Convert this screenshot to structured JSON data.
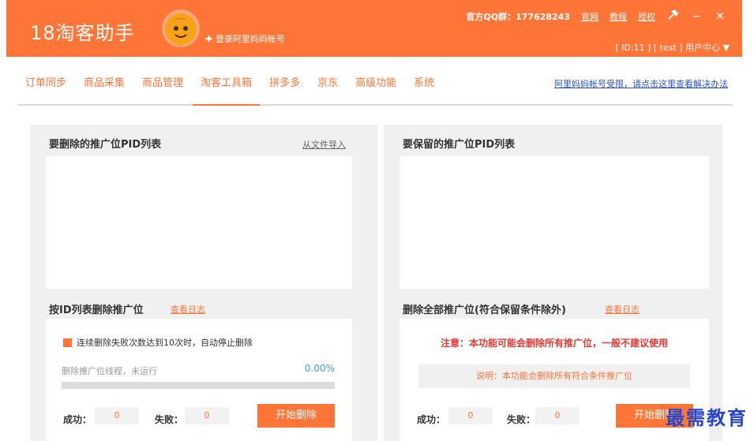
{
  "header": {
    "app_title": "18淘客助手",
    "login_link": "✚ 登录阿里妈妈帐号",
    "qq_group": "官方QQ群：177628243",
    "links": [
      "官网",
      "教程",
      "授权"
    ],
    "controls": {
      "settings": "✖",
      "minimize": "−",
      "close": "✕"
    },
    "user_line": "[ ID:11 ] [ test ] 用户中心 ▼"
  },
  "nav": {
    "tabs": [
      "订单同步",
      "商品采集",
      "商品管理",
      "淘客工具箱",
      "拼多多",
      "京东",
      "高级功能",
      "系统"
    ],
    "active_tab": "淘客工具箱",
    "help_link": "阿里妈妈帐号受限，请点击这里查看解决办法"
  },
  "left_panel": {
    "title": "要删除的推广位PID列表",
    "import_link": "从文件导入",
    "sub_title": "按ID列表删除推广位",
    "log_link": "查看日志",
    "checkbox_label": "连续删除失败次数达到10次时，自动停止删除",
    "progress_label": "删除推广位线程，未运行",
    "progress_pct": "0.00%",
    "progress_fraction": 0,
    "success_label": "成功：",
    "success_value": "0",
    "fail_label": "失败：",
    "fail_value": "0",
    "button_label": "开始删除"
  },
  "right_panel": {
    "title": "要保留的推广位PID列表",
    "sub_title": "删除全部推广位(符合保留条件除外)",
    "log_link": "查看日志",
    "warning": "注意：本功能可能会删除所有推广位，一般不建议使用",
    "description": "说明：本功能会删除所有符合条件推广位",
    "success_label": "成功：",
    "success_value": "0",
    "fail_label": "失败：",
    "fail_value": "0",
    "button_label": "开始删除"
  },
  "watermark": "最需教育",
  "colors": {
    "accent": "#fe7537",
    "link_blue": "#2b52c4",
    "progress_blue": "#3aa5d8",
    "warning_red": "#e53935"
  }
}
